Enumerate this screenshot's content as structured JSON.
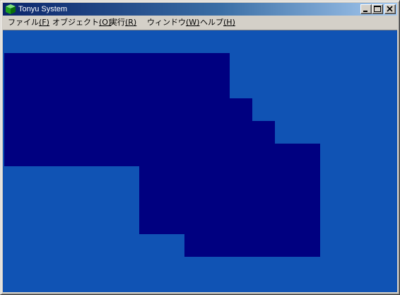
{
  "window": {
    "title": "Tonyu System",
    "controls": {
      "minimize": "minimize",
      "maximize": "maximize",
      "close": "close"
    }
  },
  "menubar": {
    "items": [
      {
        "label": "ファイル",
        "accel": "(F)"
      },
      {
        "label": "オブジェクト",
        "accel": "(O)"
      },
      {
        "label": "実行",
        "accel": "(R)"
      },
      {
        "label": "ウィンドウ",
        "accel": "(W)"
      },
      {
        "label": "ヘルプ",
        "accel": "(H)"
      }
    ]
  },
  "canvas": {
    "background_color": "#1053b4",
    "shape_color": "#000080"
  },
  "colors": {
    "titlebar_start": "#0a246a",
    "titlebar_end": "#a6caf0",
    "chrome": "#d4d0c8"
  }
}
